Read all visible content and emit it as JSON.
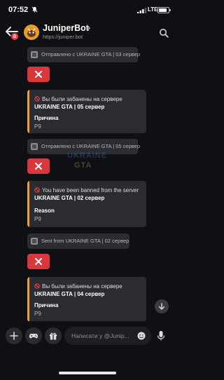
{
  "status_bar": {
    "time": "07:52",
    "network": "LTE",
    "battery_level": 0.85
  },
  "header": {
    "unread_count": "8",
    "bot_name": "JuniperBot",
    "bot_url": "https://juniper.bot"
  },
  "messages": [
    {
      "type": "footer",
      "text": "Отправлено с UKRAINE GTA | 03 сервер"
    },
    {
      "type": "close_button"
    },
    {
      "type": "embed",
      "title_prefix": "Вы были забанены на сервере ",
      "title_bold": "UKRAINE GTA | 05 сервер",
      "field_name": "Причина",
      "field_value": "P9"
    },
    {
      "type": "footer",
      "text": "Отправлено с UKRAINE GTA | 05 сервер"
    },
    {
      "type": "close_button"
    },
    {
      "type": "embed",
      "title_prefix": "You have been banned from the server ",
      "title_bold": "UKRAINE GTA | 02 сервер",
      "field_name": "Reason",
      "field_value": "P9"
    },
    {
      "type": "footer",
      "text": "Sent from UKRAINE GTA | 02 сервер"
    },
    {
      "type": "close_button"
    },
    {
      "type": "embed",
      "title_prefix": "Вы были забанены на сервере ",
      "title_bold": "UKRAINE GTA | 04 сервер",
      "field_name": "Причина",
      "field_value": "P9"
    }
  ],
  "watermark": {
    "line1": "UKRAINE",
    "line2": "GTA"
  },
  "composer": {
    "placeholder": "Написати у @Junip..."
  },
  "icons": {
    "ban": "no-entry-icon",
    "close": "x-icon",
    "jump": "arrow-down-icon",
    "plus": "plus-icon",
    "games": "gamepad-icon",
    "gift": "gift-icon",
    "emoji": "emoji-icon",
    "mic": "microphone-icon"
  },
  "colors": {
    "embed_accent": "#f0a030",
    "close_button": "#da373c",
    "badge": "#f23f43"
  }
}
